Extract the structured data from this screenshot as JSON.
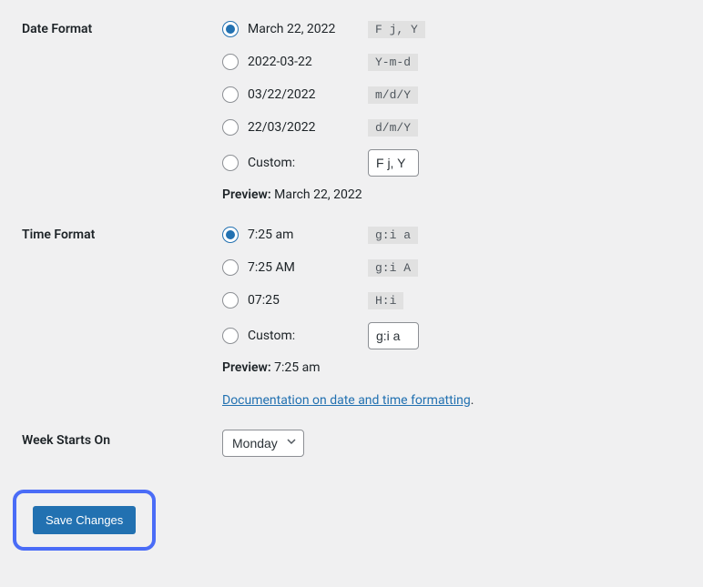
{
  "dateFormat": {
    "heading": "Date Format",
    "options": [
      {
        "label": "March 22, 2022",
        "code": "F j, Y",
        "checked": true
      },
      {
        "label": "2022-03-22",
        "code": "Y-m-d",
        "checked": false
      },
      {
        "label": "03/22/2022",
        "code": "m/d/Y",
        "checked": false
      },
      {
        "label": "22/03/2022",
        "code": "d/m/Y",
        "checked": false
      }
    ],
    "customLabel": "Custom:",
    "customValue": "F j, Y",
    "previewLabel": "Preview:",
    "previewValue": "March 22, 2022"
  },
  "timeFormat": {
    "heading": "Time Format",
    "options": [
      {
        "label": "7:25 am",
        "code": "g:i a",
        "checked": true
      },
      {
        "label": "7:25 AM",
        "code": "g:i A",
        "checked": false
      },
      {
        "label": "07:25",
        "code": "H:i",
        "checked": false
      }
    ],
    "customLabel": "Custom:",
    "customValue": "g:i a",
    "previewLabel": "Preview:",
    "previewValue": "7:25 am",
    "docLinkText": "Documentation on date and time formatting",
    "docLinkPeriod": "."
  },
  "weekStart": {
    "heading": "Week Starts On",
    "selected": "Monday"
  },
  "saveButton": "Save Changes"
}
